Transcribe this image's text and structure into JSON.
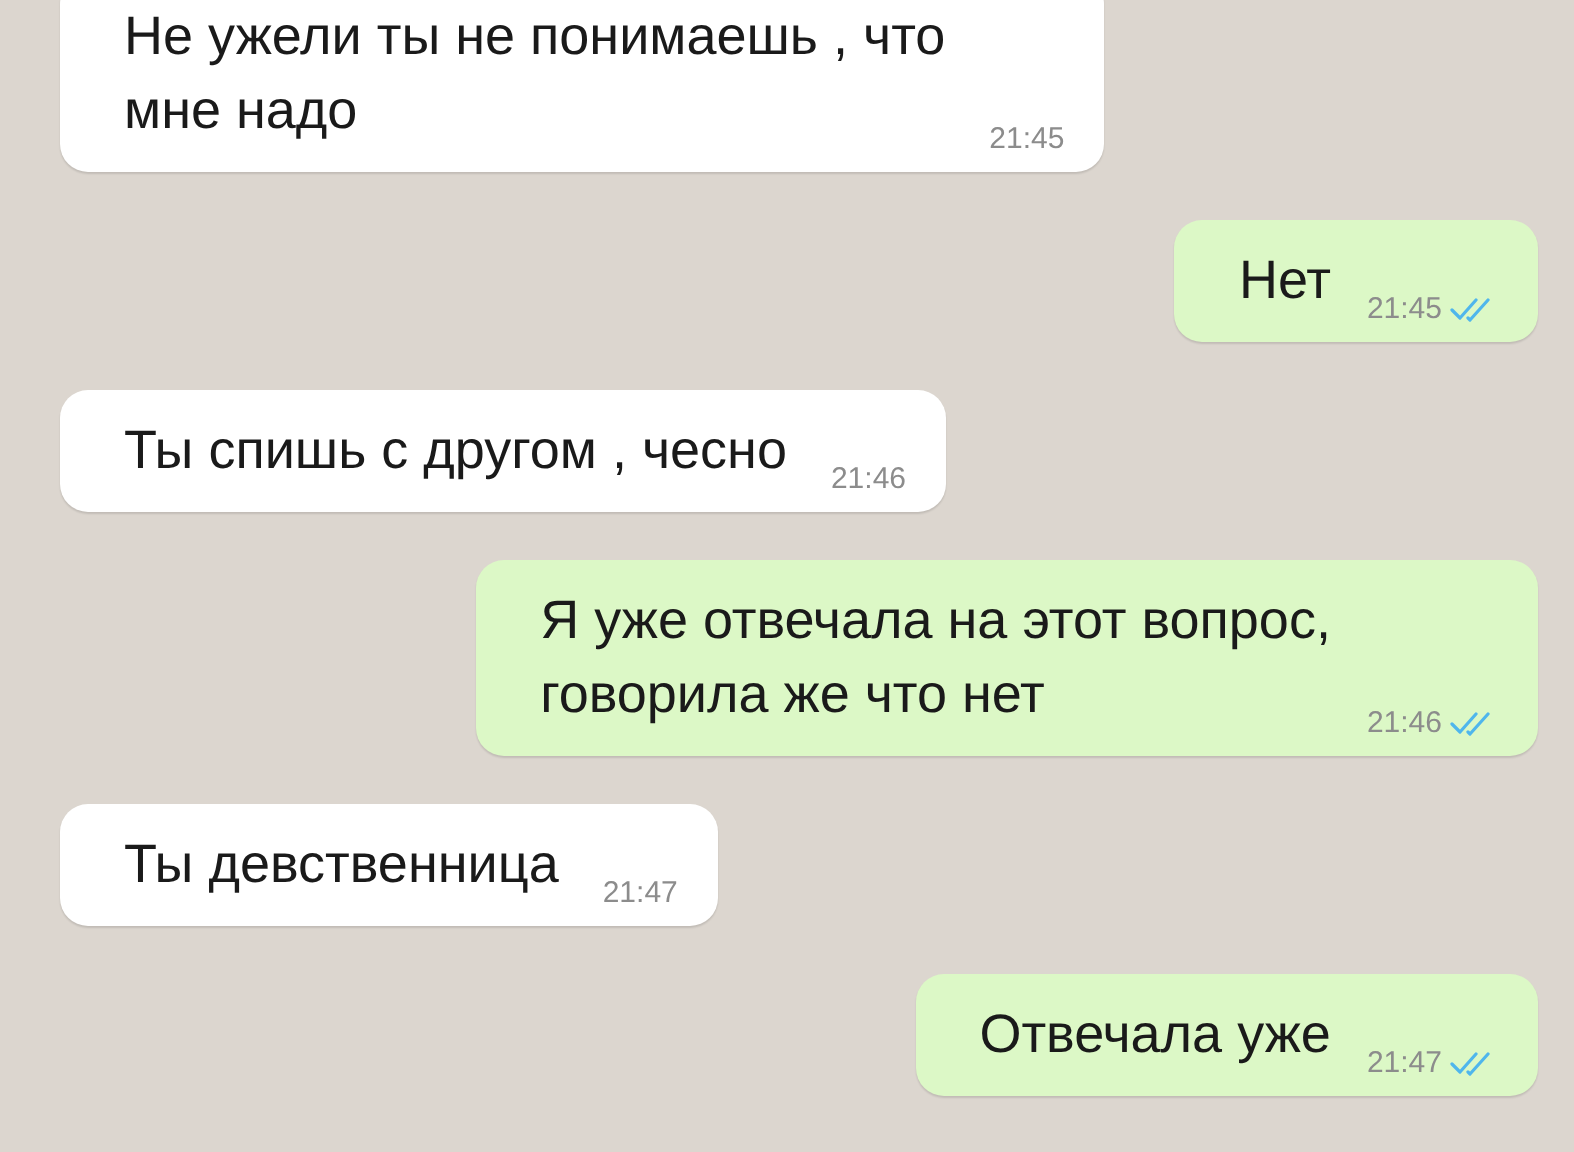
{
  "messages": [
    {
      "kind": "incoming",
      "lines": [
        "Не ужели ты не понимаешь , что",
        "мне надо"
      ],
      "time": "21:45"
    },
    {
      "kind": "outgoing",
      "lines": [
        "Нет"
      ],
      "time": "21:45",
      "read": true
    },
    {
      "kind": "incoming",
      "lines": [
        "Ты спишь с другом , чесно"
      ],
      "time": "21:46"
    },
    {
      "kind": "outgoing",
      "lines": [
        "Я уже отвечала на этот вопрос,",
        "говорила же что нет"
      ],
      "time": "21:46",
      "read": true
    },
    {
      "kind": "incoming",
      "lines": [
        "Ты девственница"
      ],
      "time": "21:47"
    },
    {
      "kind": "outgoing",
      "lines": [
        "Отвечала уже"
      ],
      "time": "21:47",
      "read": true
    }
  ]
}
